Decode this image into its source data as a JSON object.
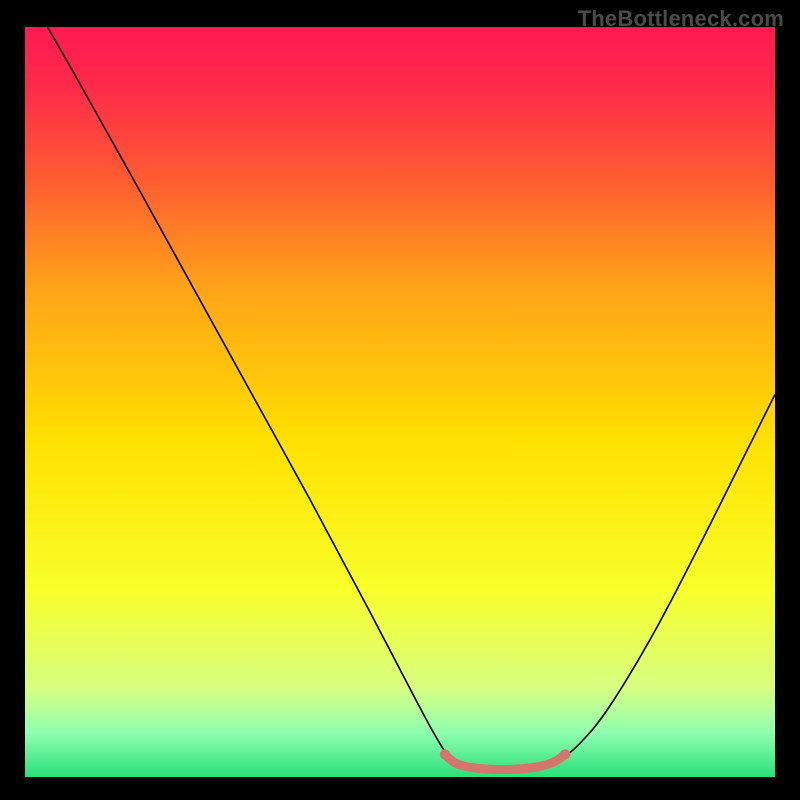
{
  "watermark": "TheBottleneck.com",
  "chart_data": {
    "type": "line",
    "title": "",
    "xlabel": "",
    "ylabel": "",
    "xlim": [
      0,
      100
    ],
    "ylim": [
      0,
      100
    ],
    "background_gradient": {
      "stops": [
        {
          "offset": 0.0,
          "color": "#ff1a52"
        },
        {
          "offset": 0.08,
          "color": "#ff2a4a"
        },
        {
          "offset": 0.2,
          "color": "#ff5a32"
        },
        {
          "offset": 0.35,
          "color": "#ffa418"
        },
        {
          "offset": 0.55,
          "color": "#ffe000"
        },
        {
          "offset": 0.75,
          "color": "#f8ff2a"
        },
        {
          "offset": 0.88,
          "color": "#d8ff80"
        },
        {
          "offset": 0.94,
          "color": "#90ffb0"
        },
        {
          "offset": 1.0,
          "color": "#29e07a"
        }
      ]
    },
    "series": [
      {
        "name": "bottleneck-curve",
        "color": "#000000",
        "width": 1.6,
        "points": [
          {
            "x": 3.0,
            "y": 100.0
          },
          {
            "x": 7.0,
            "y": 93.0
          },
          {
            "x": 14.0,
            "y": 80.5
          },
          {
            "x": 22.0,
            "y": 66.0
          },
          {
            "x": 30.0,
            "y": 51.5
          },
          {
            "x": 38.0,
            "y": 37.0
          },
          {
            "x": 46.0,
            "y": 22.0
          },
          {
            "x": 52.0,
            "y": 10.5
          },
          {
            "x": 55.0,
            "y": 5.0
          },
          {
            "x": 57.0,
            "y": 2.3
          },
          {
            "x": 60.0,
            "y": 1.2
          },
          {
            "x": 64.0,
            "y": 0.9
          },
          {
            "x": 68.0,
            "y": 1.1
          },
          {
            "x": 71.0,
            "y": 2.2
          },
          {
            "x": 74.0,
            "y": 4.5
          },
          {
            "x": 78.0,
            "y": 9.5
          },
          {
            "x": 84.0,
            "y": 19.5
          },
          {
            "x": 90.0,
            "y": 31.0
          },
          {
            "x": 96.0,
            "y": 43.0
          },
          {
            "x": 100.0,
            "y": 51.0
          }
        ]
      },
      {
        "name": "optimal-highlight",
        "color": "#d5766e",
        "width": 9,
        "cap": "round",
        "points": [
          {
            "x": 56.0,
            "y": 3.0
          },
          {
            "x": 57.5,
            "y": 1.8
          },
          {
            "x": 60.0,
            "y": 1.2
          },
          {
            "x": 64.0,
            "y": 1.0
          },
          {
            "x": 68.0,
            "y": 1.3
          },
          {
            "x": 70.5,
            "y": 2.0
          },
          {
            "x": 72.0,
            "y": 3.0
          }
        ]
      }
    ],
    "markers": [
      {
        "name": "optimal-dot-left",
        "x": 56.0,
        "y": 3.0,
        "r": 5.2,
        "color": "#d5766e"
      },
      {
        "name": "optimal-dot-right",
        "x": 72.0,
        "y": 3.0,
        "r": 5.2,
        "color": "#d5766e"
      }
    ]
  }
}
